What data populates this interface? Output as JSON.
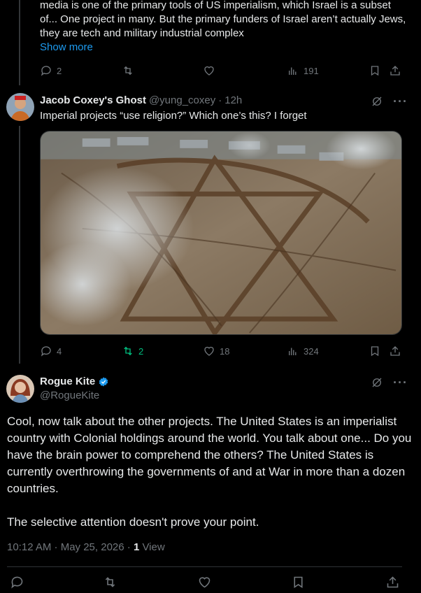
{
  "top_tweet": {
    "text": "media is one of the primary tools of US imperialism, which Israel is a subset of... One project in many. But the primary funders of Israel aren’t actually Jews, they are tech and military industrial complex",
    "show_more": "Show more",
    "replies": "2",
    "views": "191"
  },
  "reply_tweet": {
    "name": "Jacob Coxey's Ghost",
    "handle": "@yung_coxey",
    "separator": "·",
    "time": "12h",
    "text": "Imperial projects “use religion?” Which one’s this? I forget",
    "replies": "4",
    "reposts": "2",
    "likes": "18",
    "views": "324"
  },
  "main_tweet": {
    "name": "Rogue Kite",
    "handle": "@RogueKite",
    "paragraph1": "Cool, now talk about the other projects. The United States is an imperialist country with Colonial holdings around the world. You talk about one... Do you have the brain power to comprehend the others? The United States is currently overthrowing the governments of and at War in more than a dozen countries.",
    "paragraph2": "The selective attention doesn't prove your point.",
    "timestamp": "10:12 AM · May 25, 2026 · ",
    "view_count": "1",
    "view_label": " View"
  },
  "colors": {
    "background": "#000000",
    "text": "#e7e9ea",
    "muted": "#71767b",
    "link": "#1d9bf0",
    "repost_active": "#00ba7c",
    "divider": "#2f3336"
  }
}
